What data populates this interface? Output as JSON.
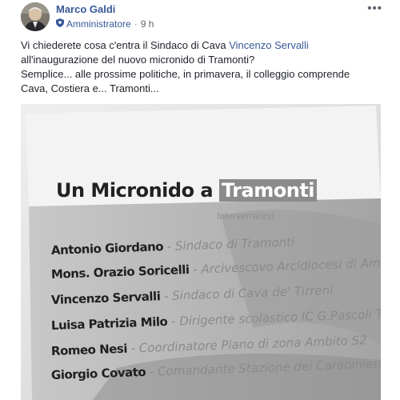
{
  "post": {
    "author": "Marco Galdi",
    "role": "Amministratore",
    "separator": "·",
    "time": "9 h",
    "more_label": "•••",
    "text": {
      "line1_before": "Vi chiederete cosa c'entra il Sindaco di Cava ",
      "mention": "Vincenzo Servalli",
      "line2": "all'inaugurazione del nuovo micronido di Tramonti?",
      "line3": "Semplice... alle prossime politiche, in primavera, il colleggio comprende",
      "line4": "Cava, Costiera e... Tramonti..."
    }
  },
  "photo": {
    "title_prefix": "Un Micronido a ",
    "title_highlight": "Tramonti",
    "subtitle": "Interverranno",
    "speakers": [
      {
        "name": "Antonio Giordano",
        "role": " - Sindaco di Tramonti"
      },
      {
        "name": "Mons. Orazio Soricelli",
        "role": " - Arcivescovo Arcidiocesi di Amalfi - Ca"
      },
      {
        "name": "Vincenzo Servalli",
        "role": " - Sindaco di Cava de' Tirreni"
      },
      {
        "name": "Luisa Patrizia Milo",
        "role": " - Dirigente scolastico IC G.Pascoli Tram"
      },
      {
        "name": "Romeo Nesi",
        "role": " - Coordinatore Piano di zona Ambito S2"
      },
      {
        "name": "Giorgio Covato",
        "role": " - Comandante Stazione dei Carabinieri di T"
      }
    ]
  },
  "colors": {
    "link": "#385898",
    "text": "#1d2129",
    "meta": "#606770"
  },
  "icons": {
    "role_badge": "shield-icon",
    "more": "more-options-icon"
  }
}
